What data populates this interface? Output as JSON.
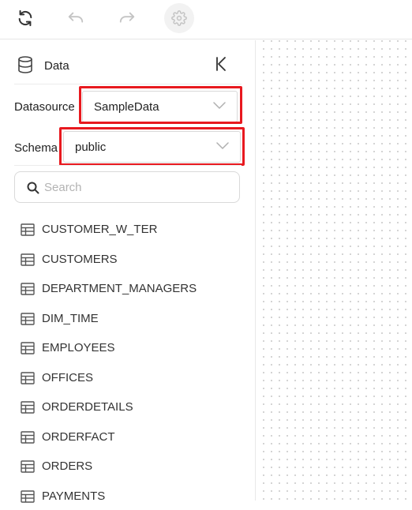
{
  "toolbar": {
    "refresh_icon": "refresh-icon",
    "undo_icon": "undo-icon",
    "redo_icon": "redo-icon",
    "settings_icon": "gear-icon"
  },
  "panel": {
    "title": "Data",
    "datasource": {
      "label": "Datasource",
      "value": "SampleData"
    },
    "schema": {
      "label": "Schema",
      "value": "public"
    },
    "search": {
      "placeholder": "Search",
      "value": ""
    },
    "tables": [
      "CUSTOMER_W_TER",
      "CUSTOMERS",
      "DEPARTMENT_MANAGERS",
      "DIM_TIME",
      "EMPLOYEES",
      "OFFICES",
      "ORDERDETAILS",
      "ORDERFACT",
      "ORDERS",
      "PAYMENTS"
    ]
  },
  "colors": {
    "highlight": "#e8191f",
    "border": "#d9d9d9",
    "icon": "#555555"
  }
}
